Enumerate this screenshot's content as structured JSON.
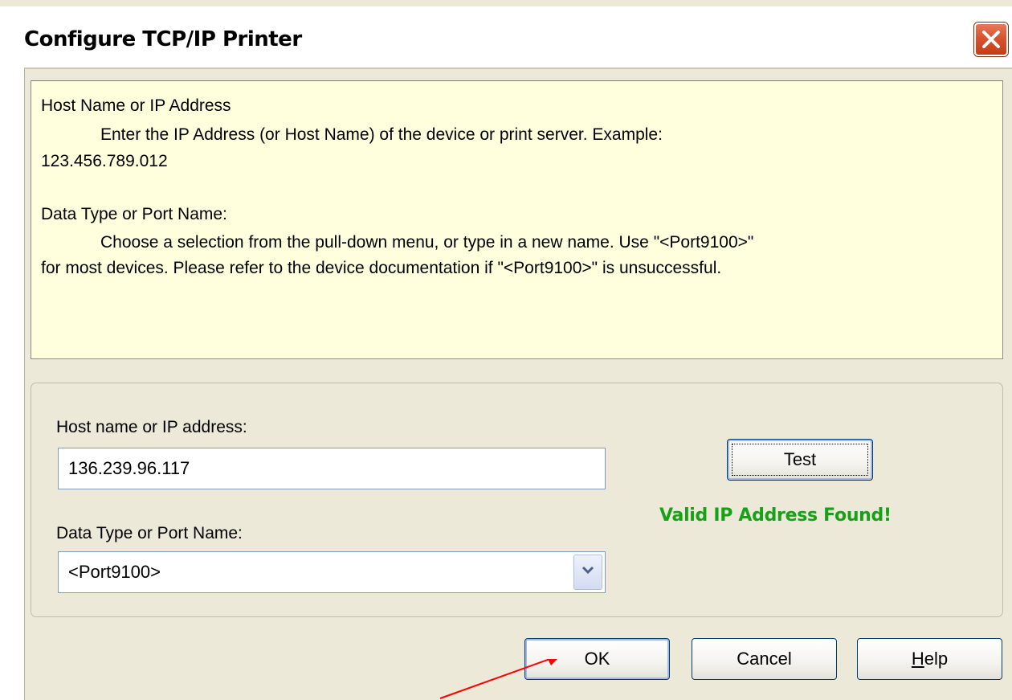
{
  "window": {
    "title": "Configure TCP/IP Printer",
    "close_icon": "close-x-icon"
  },
  "info": {
    "host_heading": "Host Name or IP Address",
    "host_desc": "Enter the IP Address (or Host Name) of the device or print server.  Example:",
    "host_example": "123.456.789.012",
    "port_heading": "Data Type or Port Name:",
    "port_desc": "Choose a selection from the pull-down menu, or type in a new name.  Use \"<Port9100>\"",
    "port_desc2": "for most devices.  Please refer to the device documentation if \"<Port9100>\" is unsuccessful."
  },
  "form": {
    "host_label": "Host name or IP address:",
    "host_value": "136.239.96.117",
    "port_label": "Data Type or Port Name:",
    "port_value": "<Port9100>",
    "dropdown_icon": "chevron-down-icon",
    "test_label": "Test",
    "status": "Valid IP Address Found!",
    "status_color": "#18a018"
  },
  "buttons": {
    "ok": "OK",
    "cancel": "Cancel",
    "help_prefix": "H",
    "help_rest": "elp"
  },
  "annotation": {
    "arrow_icon": "red-pointer-arrow",
    "color": "#ff0000"
  }
}
